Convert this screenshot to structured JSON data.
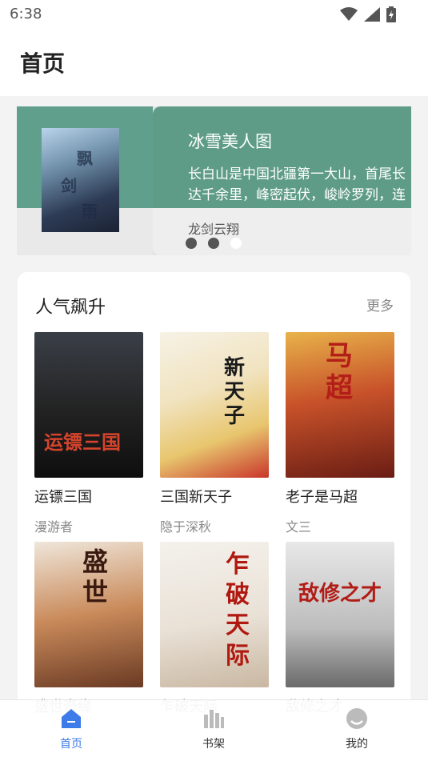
{
  "status_bar": {
    "time": "6:38"
  },
  "header": {
    "title": "首页"
  },
  "banner": {
    "title": "冰雪美人图",
    "description": "长白山是中国北疆第一大山，首尾长达千余里，峰密起伏，峻岭罗列，连",
    "author": "龙剑云翔",
    "dots": 3,
    "active_dot": 2
  },
  "popular": {
    "title": "人气飙升",
    "more": "更多",
    "books": [
      {
        "title": "运镖三国",
        "author": "漫游者",
        "cover_text": "运镖三国"
      },
      {
        "title": "三国新天子",
        "author": "隐于深秋",
        "cover_text": "新天子"
      },
      {
        "title": "老子是马超",
        "author": "文三",
        "cover_text": "马超"
      },
      {
        "title": "盛世奇缘",
        "author": "",
        "cover_text": "盛世"
      },
      {
        "title": "乍破天际",
        "author": "",
        "cover_text": "乍破天际"
      },
      {
        "title": "敌修之才",
        "author": "",
        "cover_text": "敌修之才"
      }
    ]
  },
  "tabbar": {
    "items": [
      {
        "label": "首页",
        "icon": "home-icon",
        "active": true
      },
      {
        "label": "书架",
        "icon": "bookshelf-icon",
        "active": false
      },
      {
        "label": "我的",
        "icon": "profile-icon",
        "active": false
      }
    ]
  },
  "colors": {
    "accent": "#3d7ce8",
    "banner_green": "#5e9c87"
  }
}
